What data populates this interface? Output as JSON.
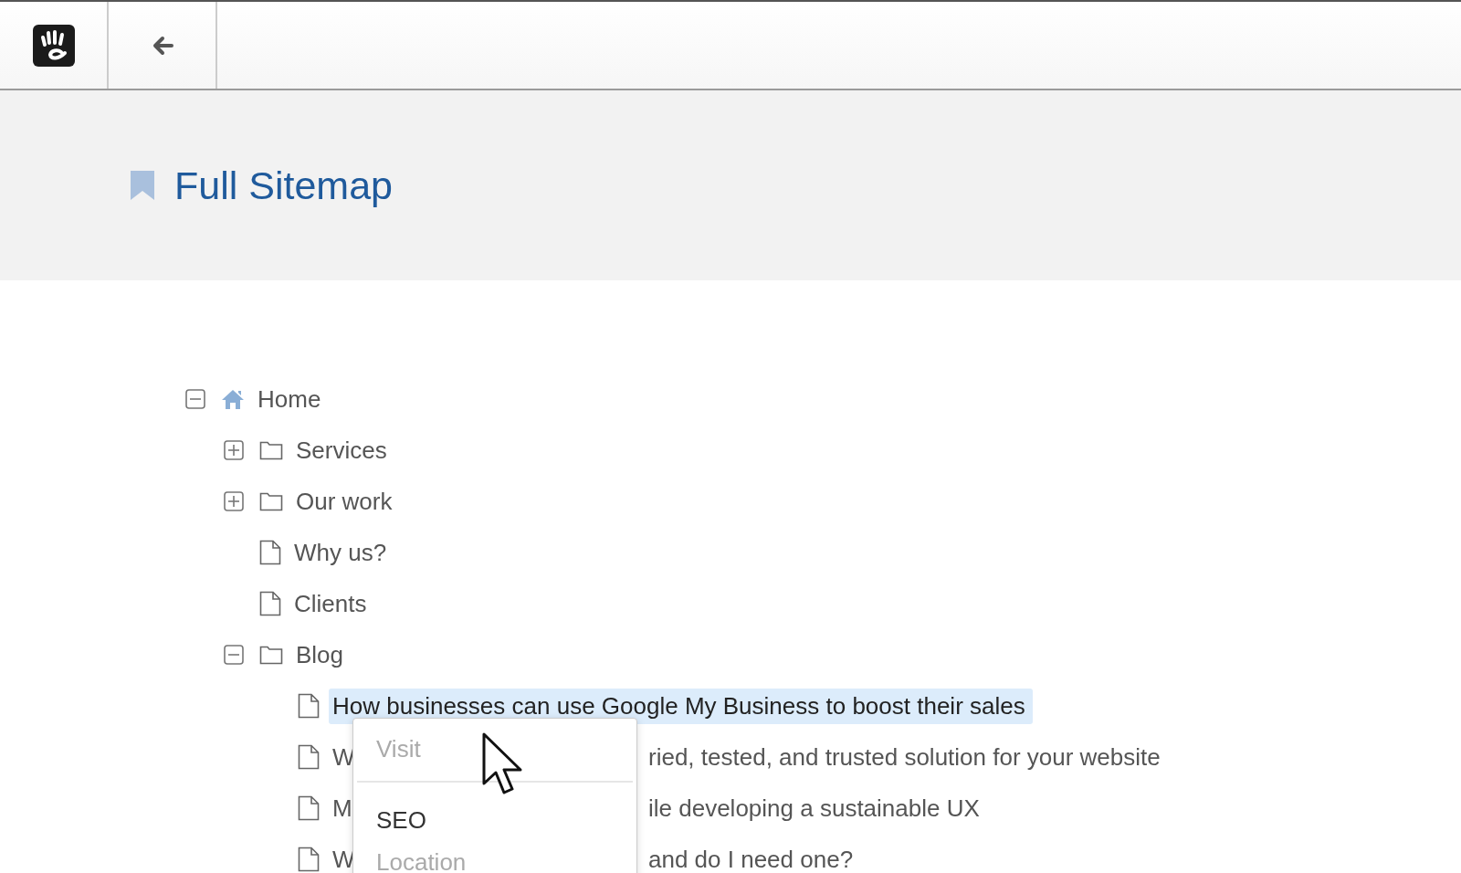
{
  "toolbar": {
    "buttons": [
      {
        "kind": "logo"
      },
      {
        "kind": "back"
      }
    ]
  },
  "header": {
    "title": "Full Sitemap"
  },
  "tree": [
    {
      "kind": "home",
      "label": "Home",
      "expanded": true,
      "selected": false,
      "children": [
        {
          "kind": "folder",
          "label": "Services",
          "expanded": false,
          "selected": false
        },
        {
          "kind": "folder",
          "label": "Our work",
          "expanded": false,
          "selected": false
        },
        {
          "kind": "page",
          "label": "Why us?",
          "selected": false
        },
        {
          "kind": "page",
          "label": "Clients",
          "selected": false
        },
        {
          "kind": "folder",
          "label": "Blog",
          "expanded": true,
          "selected": false,
          "children": [
            {
              "kind": "page",
              "label": "How businesses can use Google My Business to boost their sales",
              "selected": true
            },
            {
              "kind": "page",
              "label": "W",
              "label_after_menu": "ried, tested, and trusted solution for your website",
              "selected": false
            },
            {
              "kind": "page",
              "label": "M",
              "label_after_menu": "ile developing a sustainable UX",
              "selected": false
            },
            {
              "kind": "page",
              "label": "W",
              "label_after_menu": "and do I need one?",
              "selected": false
            }
          ]
        }
      ]
    }
  ],
  "context_menu": {
    "items": [
      {
        "kind": "item",
        "label": "Visit",
        "disabled": true
      },
      {
        "kind": "divider"
      },
      {
        "kind": "item",
        "label": "SEO",
        "disabled": false
      },
      {
        "kind": "item",
        "label": "Location",
        "disabled": true
      }
    ]
  }
}
